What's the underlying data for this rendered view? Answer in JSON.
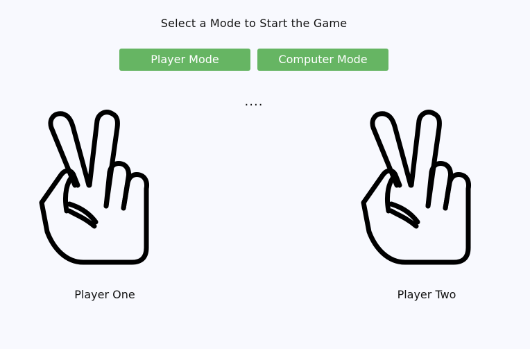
{
  "prompt": "Select a Mode to Start the Game",
  "modes": {
    "player_label": "Player Mode",
    "computer_label": "Computer Mode"
  },
  "result_text": "....",
  "players": {
    "one": {
      "name": "Player One",
      "hand_icon": "peace-hand-icon"
    },
    "two": {
      "name": "Player Two",
      "hand_icon": "peace-hand-icon"
    }
  },
  "colors": {
    "background": "#f8f9fe",
    "button": "#66b563",
    "button_text": "#ffffff",
    "text": "#111111"
  }
}
